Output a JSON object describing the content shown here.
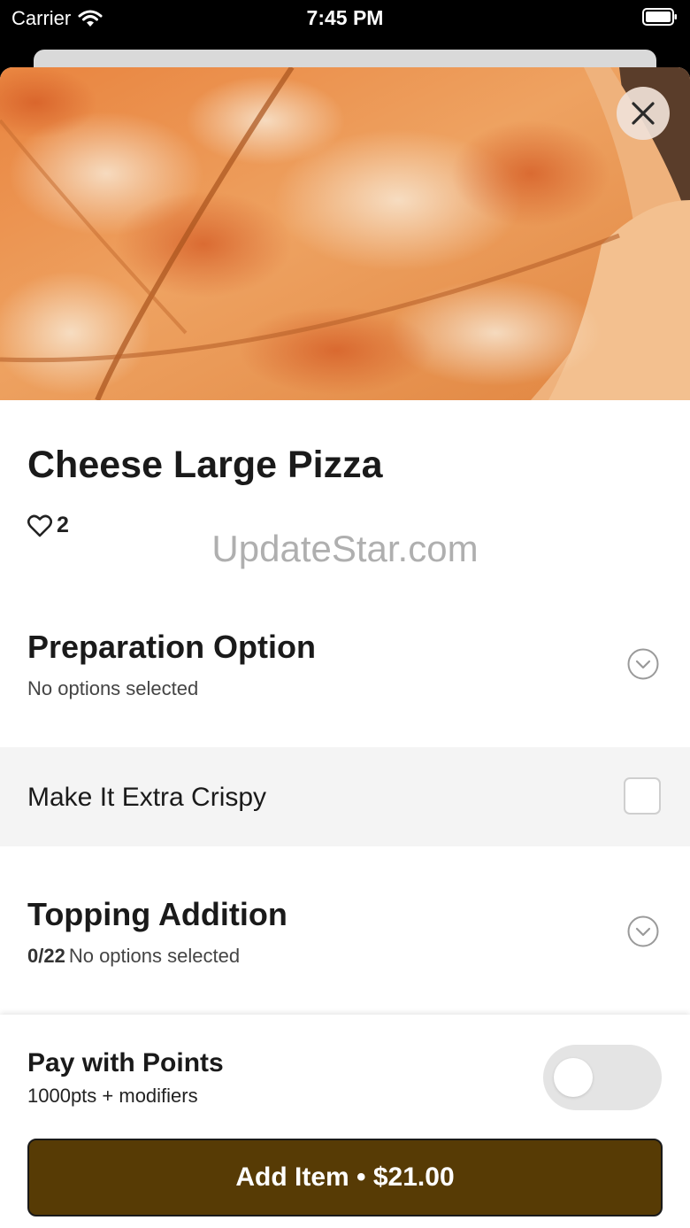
{
  "status_bar": {
    "carrier": "Carrier",
    "time": "7:45 PM",
    "icons": [
      "wifi-icon",
      "battery-icon"
    ]
  },
  "item": {
    "image": "cheese-pizza-photo",
    "title": "Cheese Large Pizza",
    "likes": "2",
    "like_icon": "heart-outline-icon"
  },
  "watermark": "UpdateStar.com",
  "sections": {
    "preparation": {
      "title": "Preparation Option",
      "subtitle": "No options selected",
      "icon": "chevron-down-circle-icon",
      "options": [
        {
          "label": "Make It Extra Crispy",
          "checked": false
        }
      ]
    },
    "topping": {
      "title": "Topping Addition",
      "count": "0/22",
      "subtitle": "No options selected",
      "icon": "chevron-down-circle-icon"
    }
  },
  "footer": {
    "points_title": "Pay with Points",
    "points_sub": "1000pts + modifiers",
    "points_toggle_on": false,
    "add_button": "Add Item • $21.00"
  },
  "colors": {
    "add_button_bg": "#573b05",
    "option_row_bg": "#f4f4f4",
    "toggle_off_bg": "#e4e4e4"
  }
}
